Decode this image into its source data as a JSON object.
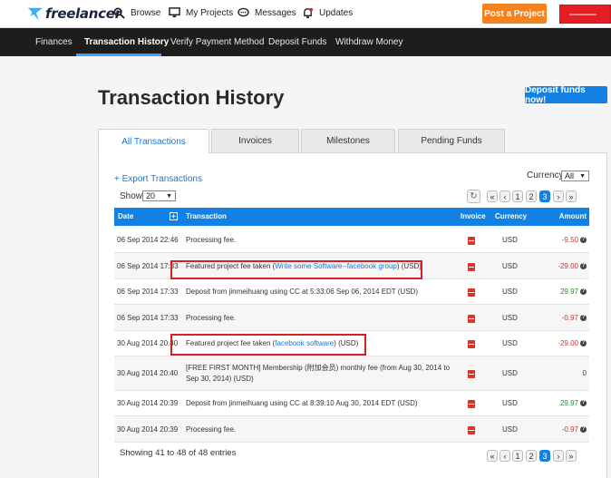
{
  "header": {
    "logo_text": "freelancer",
    "nav": [
      {
        "label": "Browse",
        "icon": "search-icon"
      },
      {
        "label": "My Projects",
        "icon": "monitor-icon"
      },
      {
        "label": "Messages",
        "icon": "chat-icon"
      },
      {
        "label": "Updates",
        "icon": "bell-icon"
      }
    ],
    "post_project": "Post a Project",
    "colors": {
      "accent_orange": "#f58220",
      "brand_blue": "#1381e3"
    }
  },
  "subnav": {
    "items": [
      "Finances",
      "Transaction History",
      "Verify Payment Method",
      "Deposit Funds",
      "Withdraw Money"
    ],
    "active": "Transaction History"
  },
  "page": {
    "title": "Transaction History",
    "deposit_button": "Deposit funds now!"
  },
  "tabs": [
    "All Transactions",
    "Invoices",
    "Milestones",
    "Pending Funds"
  ],
  "controls": {
    "export": "+ Export Transactions",
    "currency_label": "Currency",
    "currency_value": "All",
    "show_label": "Show",
    "show_value": "20"
  },
  "pagination": {
    "first": "«",
    "prev": "‹",
    "pages": [
      "1",
      "2",
      "3"
    ],
    "current": "3",
    "next": "›",
    "last": "»"
  },
  "table": {
    "columns": {
      "date": "Date",
      "transaction": "Transaction",
      "invoice": "Invoice",
      "currency": "Currency",
      "amount": "Amount"
    },
    "rows": [
      {
        "date": "06 Sep 2014 22:46",
        "pre": "Processing fee.",
        "link": "",
        "post": "",
        "currency": "USD",
        "amount": "-9.50",
        "help": "?"
      },
      {
        "date": "06 Sep 2014 17:33",
        "pre": "Featured project fee taken (",
        "link": "Write some Software--facebook group",
        "post": ") (USD)",
        "currency": "USD",
        "amount": "-29.00",
        "help": "?"
      },
      {
        "date": "06 Sep 2014 17:33",
        "pre": "Deposit from jinmeihuang using CC at 5:33:06 Sep 06, 2014 EDT (USD)",
        "link": "",
        "post": "",
        "currency": "USD",
        "amount": "29.97",
        "help": "?"
      },
      {
        "date": "06 Sep 2014 17:33",
        "pre": "Processing fee.",
        "link": "",
        "post": "",
        "currency": "USD",
        "amount": "-0.97",
        "help": "?"
      },
      {
        "date": "30 Aug 2014 20:40",
        "pre": "Featured project fee taken (",
        "link": "facebook software",
        "post": ") (USD)",
        "currency": "USD",
        "amount": "-29.00",
        "help": "?"
      },
      {
        "date": "30 Aug 2014 20:40",
        "pre": "[FREE FIRST MONTH] Membership (附加会员) monthly fee (from Aug 30, 2014 to Sep 30, 2014) (USD)",
        "link": "",
        "post": "",
        "currency": "USD",
        "amount": "0",
        "help": ""
      },
      {
        "date": "30 Aug 2014 20:39",
        "pre": "Deposit from jinmeihuang using CC at 8:39:10 Aug 30, 2014 EDT (USD)",
        "link": "",
        "post": "",
        "currency": "USD",
        "amount": "29.97",
        "help": "?"
      },
      {
        "date": "30 Aug 2014 20:39",
        "pre": "Processing fee.",
        "link": "",
        "post": "",
        "currency": "USD",
        "amount": "-0.97",
        "help": "?"
      }
    ]
  },
  "footer": {
    "showing": "Showing 41 to 48 of 48 entries"
  }
}
